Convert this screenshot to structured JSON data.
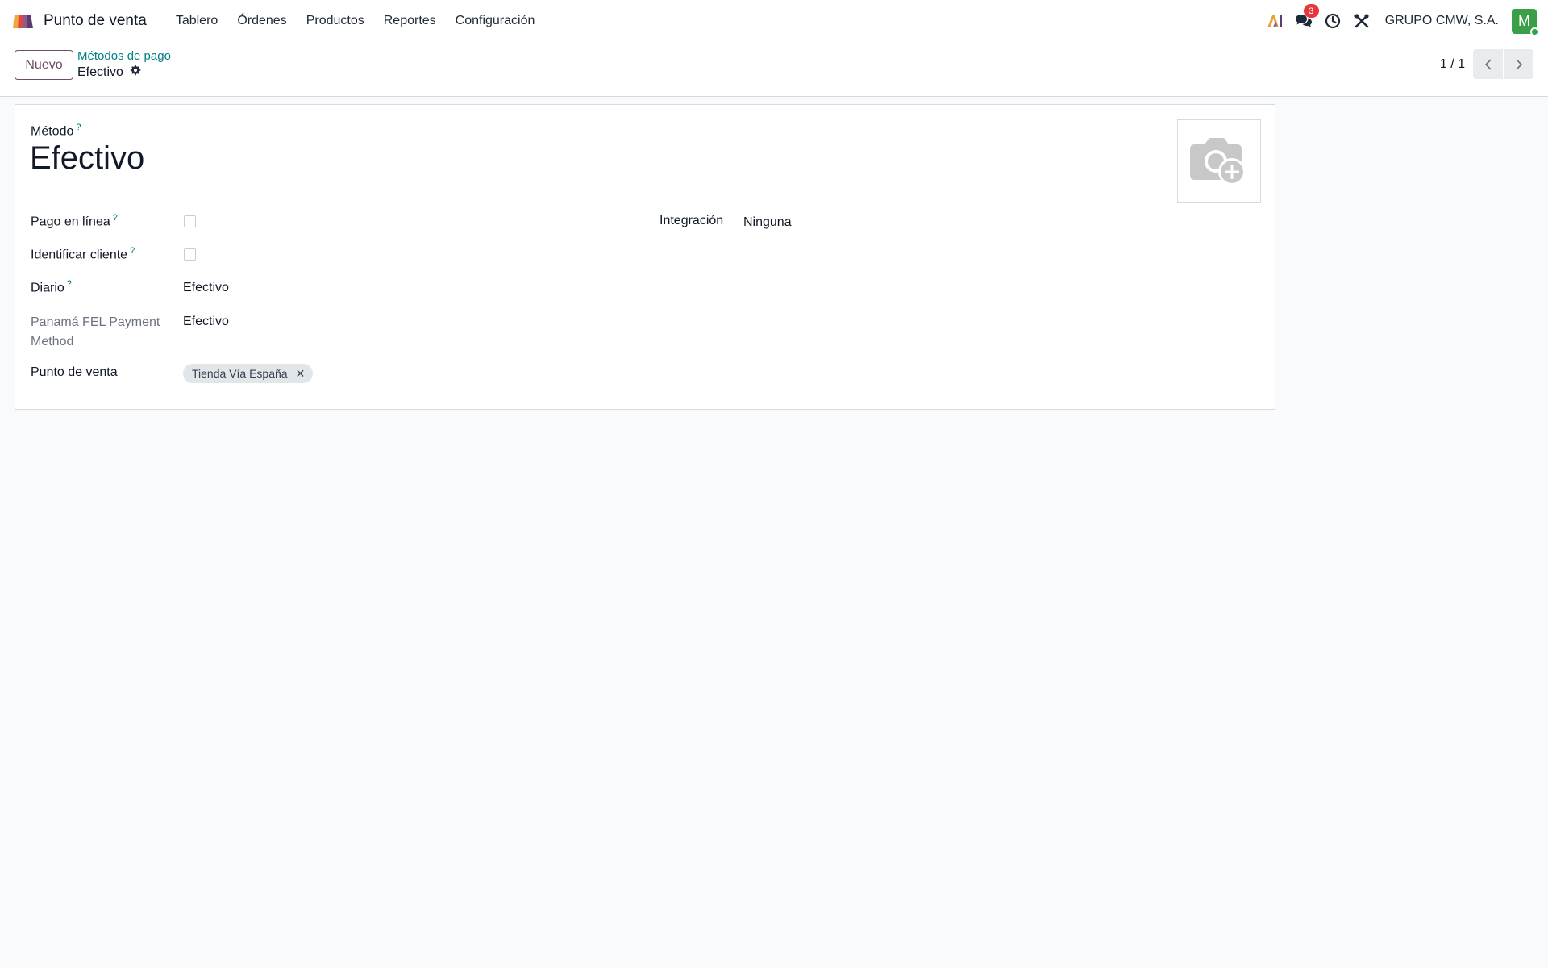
{
  "navbar": {
    "app_name": "Punto de venta",
    "menu": [
      {
        "label": "Tablero"
      },
      {
        "label": "Órdenes"
      },
      {
        "label": "Productos"
      },
      {
        "label": "Reportes"
      },
      {
        "label": "Configuración"
      }
    ],
    "messages_badge": "3",
    "company": "GRUPO CMW, S.A.",
    "avatar_initial": "M"
  },
  "control": {
    "new_button": "Nuevo",
    "breadcrumb_parent": "Métodos de pago",
    "breadcrumb_current": "Efectivo",
    "pager": "1 / 1"
  },
  "form": {
    "title_label": "Método",
    "title_value": "Efectivo",
    "fields": {
      "online_payment": {
        "label": "Pago en línea",
        "checked": false
      },
      "identify_customer": {
        "label": "Identificar cliente",
        "checked": false
      },
      "journal": {
        "label": "Diario",
        "value": "Efectivo"
      },
      "fel_method": {
        "label": "Panamá FEL Payment Method",
        "value": "Efectivo"
      },
      "pos": {
        "label": "Punto de venta",
        "tags": [
          "Tienda Vía España"
        ]
      },
      "integration": {
        "label": "Integración",
        "value": "Ninguna"
      }
    },
    "help_mark": "?"
  },
  "colors": {
    "brand": "#714b67",
    "link": "#017e84",
    "badge": "#e5383b",
    "avatar": "#3aa047"
  },
  "icons": {
    "app_logo": "point-of-sale-logo",
    "ai": "ai-icon",
    "messages": "chat-icon",
    "activities": "clock-icon",
    "tools": "tools-icon",
    "gear": "gear-icon",
    "image_placeholder": "camera-plus-icon"
  }
}
